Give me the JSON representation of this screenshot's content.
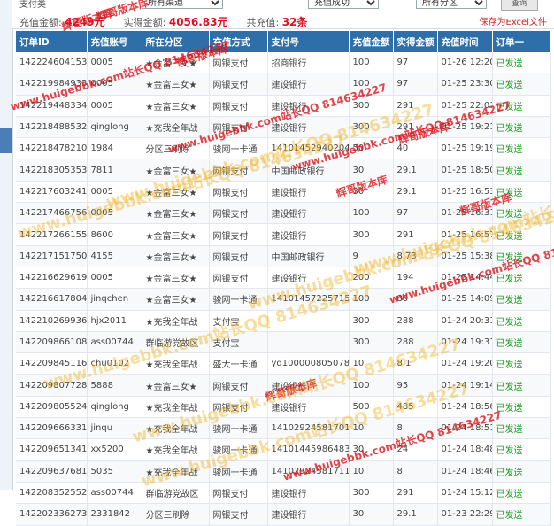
{
  "filters": {
    "type_label": "支付类",
    "type_value": "所有渠道",
    "status_value": "充值成功",
    "region_value": "所有分区",
    "query_button": "查询"
  },
  "stats": {
    "recharge_label": "充值金额:",
    "recharge_value": "4249元",
    "actual_label": "实得金额:",
    "actual_value": "4056.83元",
    "count_label": "共充值:",
    "count_value": "32条"
  },
  "export_link": "保存为Excel文件",
  "table": {
    "columns": [
      "订单ID",
      "充值账号",
      "所在分区",
      "充值方式",
      "支付号",
      "充值金额",
      "实得金额",
      "充值时间",
      "订单一"
    ],
    "rows": [
      [
        "1422246041539",
        "0005",
        "★金富三女★",
        "网银支付",
        "招商银行",
        "100",
        "97",
        "01-26 12:20",
        "已发送"
      ],
      [
        "1422199849338",
        "0005",
        "★金富三女★",
        "网银支付",
        "建设银行",
        "100",
        "97",
        "01-25 23:30",
        "已发送"
      ],
      [
        "1422194483349",
        "0005",
        "★金富三女★",
        "网银支付",
        "建设银行",
        "300",
        "291",
        "01-25 22:01",
        "已发送"
      ],
      [
        "1422184885326",
        "qinglong",
        "★充我全年战",
        "网银支付",
        "建设银行",
        "300",
        "291",
        "01-25 19:21",
        "已发送"
      ],
      [
        "1422184782105",
        "1984",
        "分区三刷除",
        "骏网一卡通",
        "1410145294020445",
        "50",
        "40",
        "01-25 19:19",
        "已发送"
      ],
      [
        "1422183053535",
        "7811",
        "★金富三女★",
        "网银支付",
        "中国邮政银行",
        "30",
        "29.1",
        "01-25 18:50",
        "已发送"
      ],
      [
        "1422176032413",
        "0005",
        "★金富三女★",
        "网银支付",
        "建设银行",
        "30",
        "29.1",
        "01-25 16:53",
        "已发送"
      ],
      [
        "1422174667564",
        "0005",
        "★金富三女★",
        "网银支付",
        "建设银行",
        "100",
        "97",
        "01-25 16:31",
        "已发送"
      ],
      [
        "1422172661554",
        "8600",
        "★金富三女★",
        "网银支付",
        "建设银行",
        "300",
        "291",
        "01-25 16:57",
        "已发送"
      ],
      [
        "1422171517505",
        "4155",
        "★金富三女★",
        "网银支付",
        "中国邮政银行",
        "9",
        "8.73",
        "01-25 15:38",
        "已发送"
      ],
      [
        "1422166296196",
        "0005",
        "★金富三女★",
        "网银支付",
        "建设银行",
        "200",
        "194",
        "01-25 14:44",
        "已发送"
      ],
      [
        "1422166178041",
        "jinqchen",
        "★金富三女★",
        "骏网一卡通",
        "1410145722571502",
        "100",
        "80",
        "01-25 14:09",
        "已发送"
      ],
      [
        "1422102699367",
        "hjx2011",
        "★充我全年战",
        "支付宝",
        "",
        "300",
        "288",
        "01-24 20:31",
        "已发送"
      ],
      [
        "1422098661088",
        "ass00744",
        "群临游党故区",
        "支付宝",
        "",
        "300",
        "288",
        "01-24 19:31",
        "已发送"
      ],
      [
        "1422098451166",
        "chu0102",
        "★充我全年战",
        "盛大一卡通",
        "yd1000008050788",
        "10",
        "8.1",
        "01-24 19:20",
        "已发送"
      ],
      [
        "1422098077288",
        "5888",
        "★金富三女★",
        "网银支付",
        "建设银行",
        "100",
        "95",
        "01-24 19:14",
        "已发送"
      ],
      [
        "1422098055246",
        "qinglong",
        "★充我全年战",
        "网银支付",
        "建设银行",
        "500",
        "485",
        "01-24 18:56",
        "已发送"
      ],
      [
        "1422096663316",
        "jinqu",
        "★充我全年战",
        "骏网一卡通",
        "1410292458170169",
        "10",
        "8",
        "01-24 18:51",
        "已发送"
      ],
      [
        "1422096513416",
        "xx5200",
        "★充我全年战",
        "骏网一卡通",
        "1410144598648324",
        "30",
        "24",
        "01-24 18:48",
        "已发送"
      ],
      [
        "1422096376812",
        "5035",
        "★充我全年战",
        "骏网一卡通",
        "1410292458171192",
        "10",
        "8",
        "01-24 18:46",
        "已发送"
      ],
      [
        "1422083525524",
        "ass00744",
        "群临游党故区",
        "网银支付",
        "建设银行",
        "300",
        "291",
        "01-24 15:12",
        "已发送"
      ],
      [
        "1422023362735",
        "2331842",
        "分区三刷除",
        "网银支付",
        "建设银行",
        "30",
        "29.1",
        "01-23 22:29",
        "已发送"
      ]
    ]
  },
  "watermarks": {
    "red": "辉哥版本库",
    "site": "www.huigebbk.com站长QQ 814634227"
  }
}
